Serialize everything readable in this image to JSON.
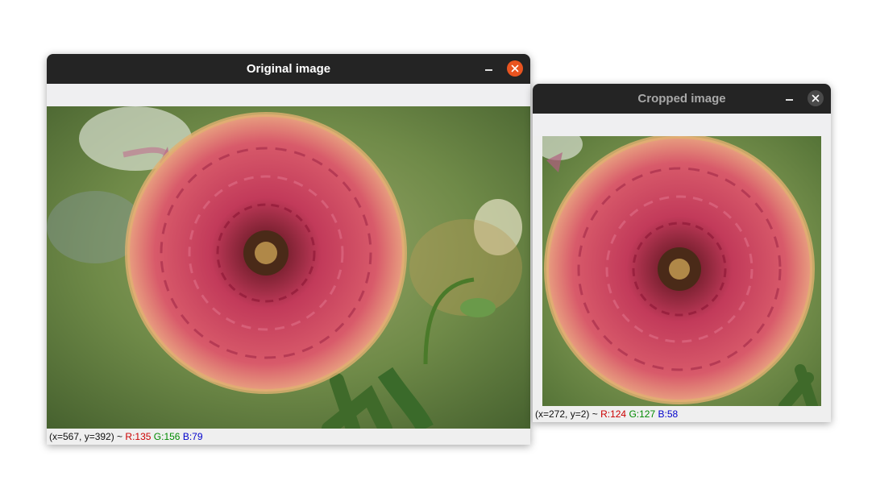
{
  "windows": {
    "original": {
      "title": "Original image",
      "status": {
        "coords": "(x=567, y=392) ~",
        "r": "R:135",
        "g": "G:156",
        "b": "B:79"
      }
    },
    "cropped": {
      "title": "Cropped image",
      "status": {
        "coords": "(x=272, y=2) ~",
        "r": "R:124",
        "g": "G:127",
        "b": "B:58"
      }
    }
  },
  "colors": {
    "titlebar": "#242424",
    "close_active": "#e95420",
    "close_inactive": "#4a4a4a",
    "petal": "#c23a5a",
    "leaf": "#5a8a3a"
  },
  "icons": {
    "minimize": "minimize-icon",
    "close": "close-icon",
    "image": "dahlia-flower-photo"
  }
}
